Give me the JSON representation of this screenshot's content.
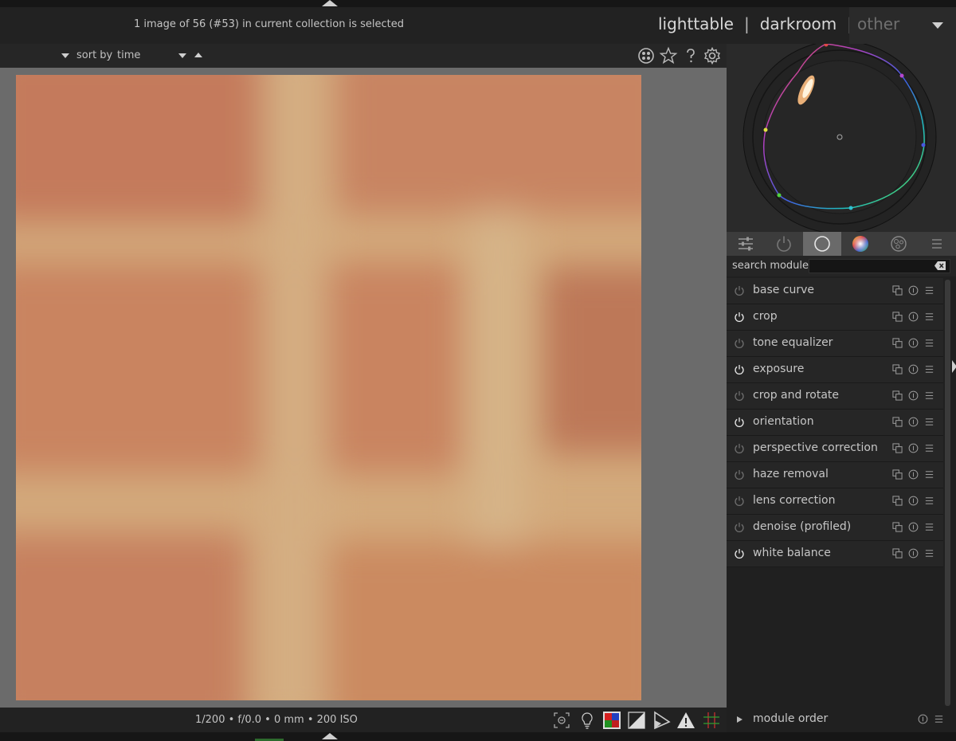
{
  "header": {
    "status_text": "1 image of 56 (#53) in current collection is selected",
    "views": [
      "lighttable",
      "darkroom",
      "other"
    ],
    "separator": "|"
  },
  "filterbar": {
    "sort_label": "sort by",
    "sort_value": "time",
    "icons": [
      "grouping-icon",
      "star-icon",
      "help-icon",
      "gear-icon"
    ]
  },
  "image": {
    "description_colors": {
      "brick": "#c98a64",
      "mortar": "#d9b584"
    }
  },
  "right_panel": {
    "tabs": [
      "sliders-icon",
      "power-icon",
      "circle-icon",
      "color-icon",
      "effects-icon",
      "menu-icon"
    ],
    "active_tab": 2,
    "search_label": "search module",
    "search_value": "",
    "modules": [
      {
        "name": "base curve",
        "on": false
      },
      {
        "name": "crop",
        "on": true
      },
      {
        "name": "tone equalizer",
        "on": false
      },
      {
        "name": "exposure",
        "on": true
      },
      {
        "name": "crop and rotate",
        "on": false
      },
      {
        "name": "orientation",
        "on": true
      },
      {
        "name": "perspective correction",
        "on": false
      },
      {
        "name": "haze removal",
        "on": false
      },
      {
        "name": "lens correction",
        "on": false
      },
      {
        "name": "denoise (profiled)",
        "on": false
      },
      {
        "name": "white balance",
        "on": true
      }
    ],
    "module_order_label": "module order"
  },
  "bottombar": {
    "exif": "1/200 • f/0.0 • 0 mm • 200 ISO",
    "icons": [
      "focus-peak-icon",
      "bulb-icon",
      "color-assessment-icon",
      "softproof-icon",
      "gamut-icon",
      "overexposed-warning-icon",
      "guides-icon"
    ]
  },
  "colors": {
    "accent_active_tab": "#6a6a6a",
    "panel_bg": "#202020",
    "image_bg": "#6b6b6b"
  }
}
